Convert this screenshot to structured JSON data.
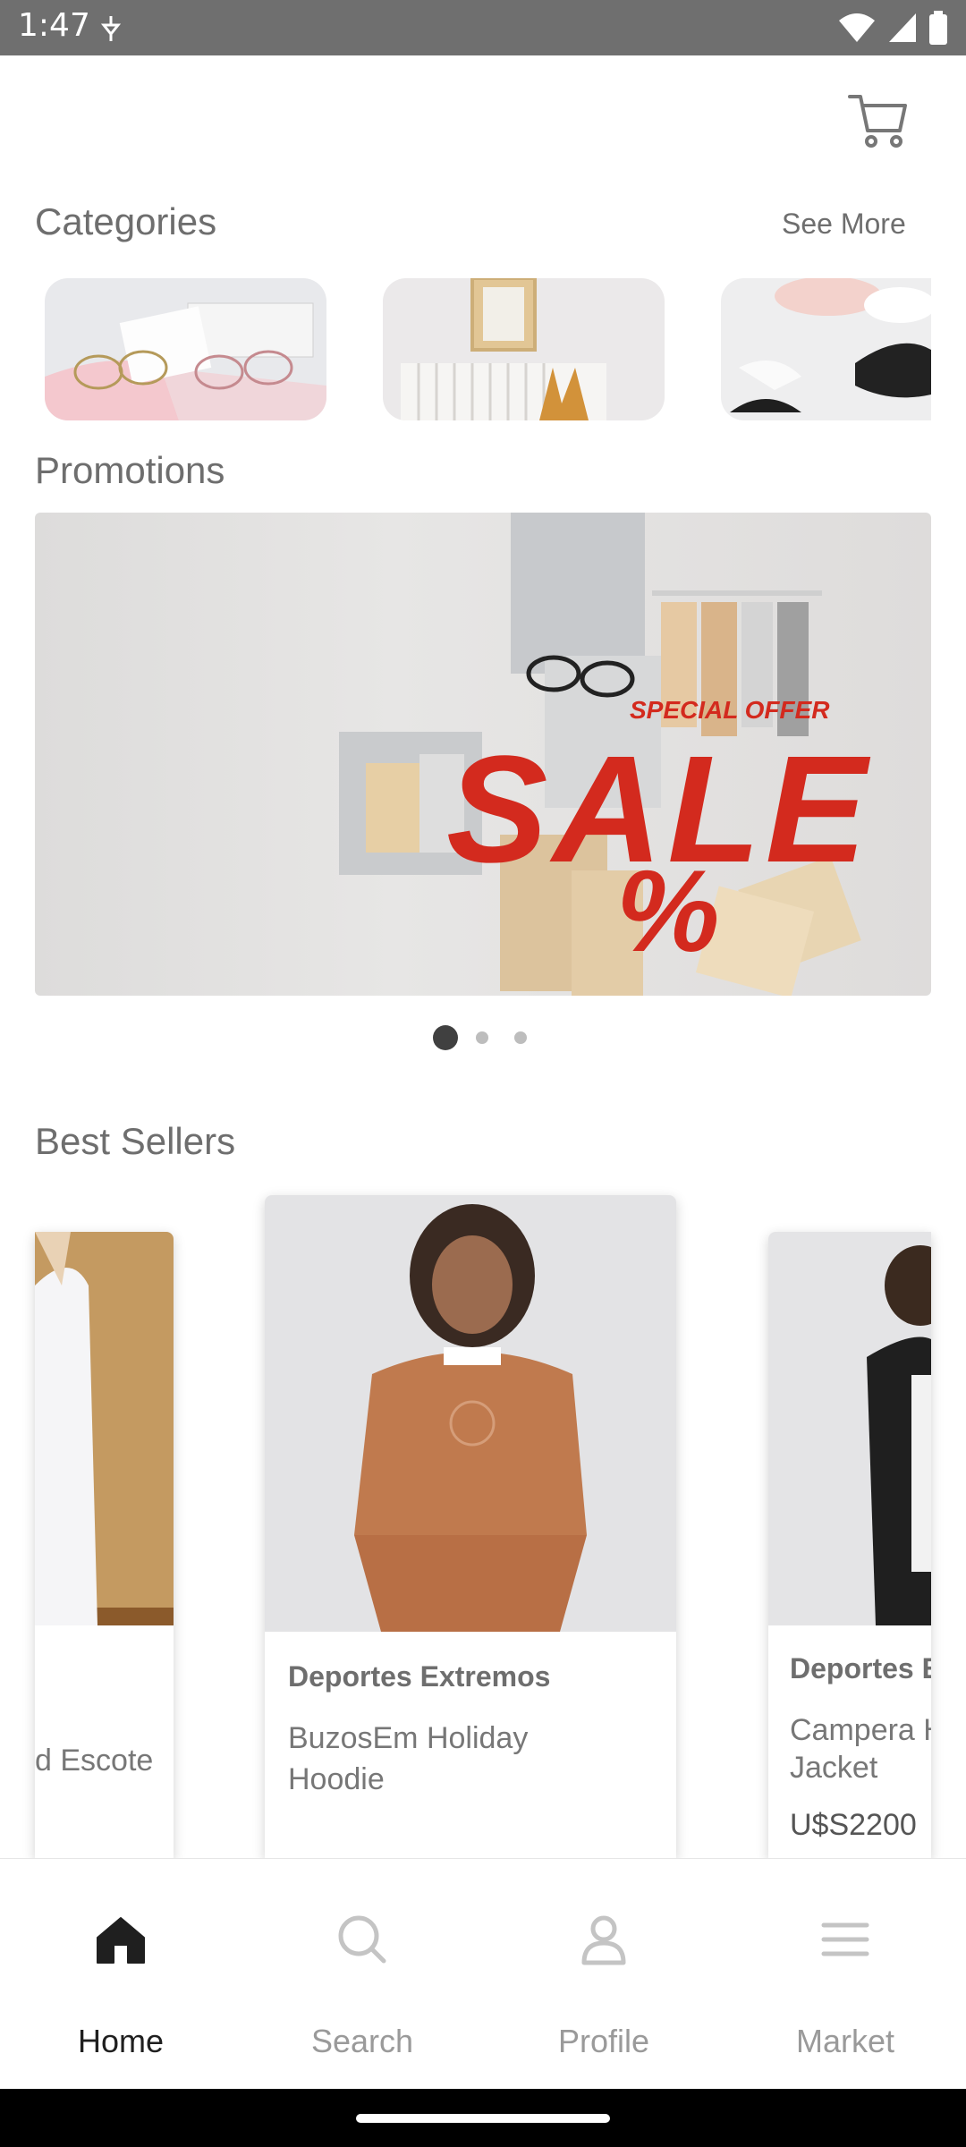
{
  "status": {
    "time": "1:47"
  },
  "categories": {
    "title": "Categories",
    "see_more": "See More"
  },
  "promotions": {
    "title": "Promotions",
    "banner": {
      "line1": "SPECIAL OFFER",
      "line2": "SALE",
      "line3": "%"
    }
  },
  "best_sellers": {
    "title": "Best Sellers",
    "items": [
      {
        "brand": "",
        "name": "d Escote"
      },
      {
        "brand": "Deportes Extremos",
        "name_line1": "BuzosEm Holiday",
        "name_line2": "Hoodie"
      },
      {
        "brand": "Deportes E",
        "name_line1": "Campera H",
        "name_line2": "Jacket",
        "price": "U$S2200"
      }
    ]
  },
  "nav": {
    "items": [
      {
        "label": "Home",
        "icon": "home-icon"
      },
      {
        "label": "Search",
        "icon": "search-icon"
      },
      {
        "label": "Profile",
        "icon": "profile-icon"
      },
      {
        "label": "Market",
        "icon": "menu-icon"
      }
    ]
  },
  "colors": {
    "accent_sale": "#d32a1e",
    "nav_active": "#1f1f1f",
    "nav_inactive": "#9a9a9a"
  }
}
